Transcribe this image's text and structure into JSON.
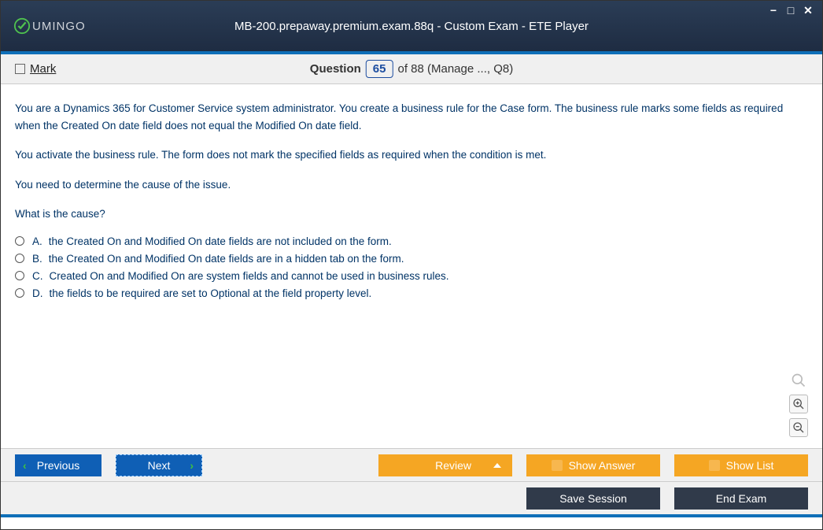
{
  "window": {
    "title": "MB-200.prepaway.premium.exam.88q - Custom Exam - ETE Player",
    "brand": "UMINGO"
  },
  "infobar": {
    "mark": "Mark",
    "question_label": "Question",
    "current": "65",
    "total_suffix": "of 88 (Manage ..., Q8)"
  },
  "question": {
    "para1": "You are a Dynamics 365 for Customer Service system administrator. You create a business rule for the Case form. The business rule marks some fields as required when the Created On date field does not equal the Modified On date field.",
    "para2": "You activate the business rule. The form does not mark the specified fields as required when the condition is met.",
    "para3": "You need to determine the cause of the issue.",
    "para4": "What is the cause?"
  },
  "options": [
    {
      "letter": "A.",
      "text": "the Created On and Modified On date fields are not included on the form."
    },
    {
      "letter": "B.",
      "text": "the Created On and Modified On date fields are in a hidden tab on the form."
    },
    {
      "letter": "C.",
      "text": "Created On and Modified On are system fields and cannot be used in business rules."
    },
    {
      "letter": "D.",
      "text": "the fields to be required are set to Optional at the field property level."
    }
  ],
  "footer": {
    "previous": "Previous",
    "next": "Next",
    "review": "Review",
    "show_answer": "Show Answer",
    "show_list": "Show List",
    "save_session": "Save Session",
    "end_exam": "End Exam"
  }
}
